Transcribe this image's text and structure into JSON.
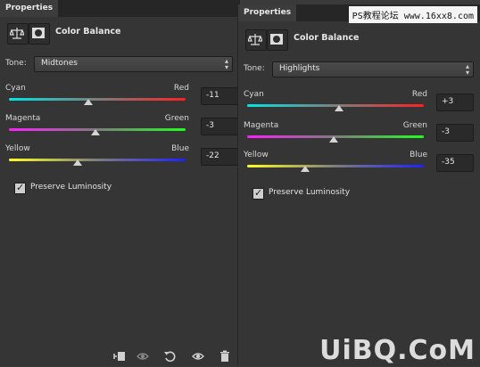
{
  "watermark": {
    "top_text": "PS教程论坛 www.16xx8.com",
    "brand": "UiBQ.CoM",
    "brand_sub": ""
  },
  "panels": [
    {
      "tab": "Properties",
      "title": "Color Balance",
      "tone_label": "Tone:",
      "tone_value": "Midtones",
      "sliders": [
        {
          "left": "Cyan",
          "right": "Red",
          "value": "-11",
          "pos": 0.45
        },
        {
          "left": "Magenta",
          "right": "Green",
          "value": "-3",
          "pos": 0.49
        },
        {
          "left": "Yellow",
          "right": "Blue",
          "value": "-22",
          "pos": 0.39
        }
      ],
      "preserve_luminosity": {
        "label": "Preserve Luminosity",
        "checked": true
      }
    },
    {
      "tab": "Properties",
      "title": "Color Balance",
      "tone_label": "Tone:",
      "tone_value": "Highlights",
      "sliders": [
        {
          "left": "Cyan",
          "right": "Red",
          "value": "+3",
          "pos": 0.52
        },
        {
          "left": "Magenta",
          "right": "Green",
          "value": "-3",
          "pos": 0.49
        },
        {
          "left": "Yellow",
          "right": "Blue",
          "value": "-35",
          "pos": 0.33
        }
      ],
      "preserve_luminosity": {
        "label": "Preserve Luminosity",
        "checked": true
      }
    }
  ],
  "bottom_bar": {
    "icons": [
      "clip-to-layer-icon",
      "view-previous-icon",
      "reset-icon",
      "visibility-eye-icon",
      "delete-trash-icon"
    ]
  },
  "colors": {
    "panel_bg": "#353535",
    "tab_bg": "#3c3c3c",
    "tabbar_bg": "#262626"
  }
}
